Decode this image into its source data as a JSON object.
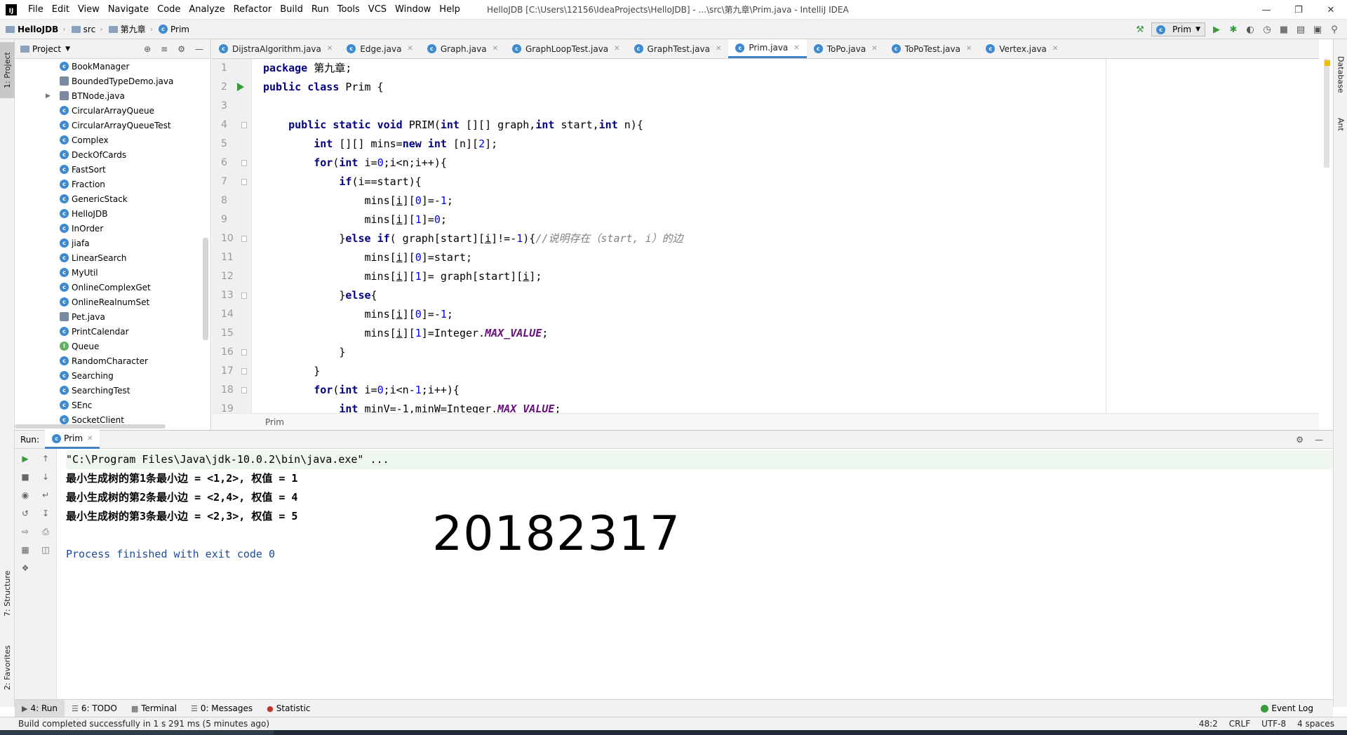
{
  "titlebar": {
    "menus": [
      "File",
      "Edit",
      "View",
      "Navigate",
      "Code",
      "Analyze",
      "Refactor",
      "Build",
      "Run",
      "Tools",
      "VCS",
      "Window",
      "Help"
    ],
    "title": "HelloJDB [C:\\Users\\12156\\IdeaProjects\\HelloJDB] - ...\\src\\第九章\\Prim.java - IntelliJ IDEA"
  },
  "navbar": {
    "crumbs": [
      "HelloJDB",
      "src",
      "第九章",
      "Prim"
    ],
    "run_config": "Prim"
  },
  "left_stripe": {
    "project_tab": "1: Project",
    "structure_tab": "7: Structure",
    "favorites_tab": "2: Favorites"
  },
  "right_stripe": {
    "database_tab": "Database",
    "ant_tab": "Ant"
  },
  "project": {
    "title": "Project",
    "items": [
      {
        "name": "BookManager",
        "kind": "class"
      },
      {
        "name": "BoundedTypeDemo.java",
        "kind": "file"
      },
      {
        "name": "BTNode.java",
        "kind": "file"
      },
      {
        "name": "CircularArrayQueue",
        "kind": "class"
      },
      {
        "name": "CircularArrayQueueTest",
        "kind": "class"
      },
      {
        "name": "Complex",
        "kind": "class"
      },
      {
        "name": "DeckOfCards",
        "kind": "class"
      },
      {
        "name": "FastSort",
        "kind": "class"
      },
      {
        "name": "Fraction",
        "kind": "class"
      },
      {
        "name": "GenericStack",
        "kind": "class"
      },
      {
        "name": "HelloJDB",
        "kind": "class"
      },
      {
        "name": "InOrder",
        "kind": "class"
      },
      {
        "name": "jiafa",
        "kind": "class"
      },
      {
        "name": "LinearSearch",
        "kind": "class"
      },
      {
        "name": "MyUtil",
        "kind": "class"
      },
      {
        "name": "OnlineComplexGet",
        "kind": "class"
      },
      {
        "name": "OnlineRealnumSet",
        "kind": "class"
      },
      {
        "name": "Pet.java",
        "kind": "file"
      },
      {
        "name": "PrintCalendar",
        "kind": "class"
      },
      {
        "name": "Queue",
        "kind": "interface"
      },
      {
        "name": "RandomCharacter",
        "kind": "class"
      },
      {
        "name": "Searching",
        "kind": "class"
      },
      {
        "name": "SearchingTest",
        "kind": "class"
      },
      {
        "name": "SEnc",
        "kind": "class"
      },
      {
        "name": "SocketClient",
        "kind": "class"
      }
    ]
  },
  "editor": {
    "tabs": [
      "DijstraAlgorithm.java",
      "Edge.java",
      "Graph.java",
      "GraphLoopTest.java",
      "GraphTest.java",
      "Prim.java",
      "ToPo.java",
      "ToPoTest.java",
      "Vertex.java"
    ],
    "active_tab": "Prim.java",
    "line_numbers": [
      "1",
      "2",
      "3",
      "4",
      "5",
      "6",
      "7",
      "8",
      "9",
      "10",
      "11",
      "12",
      "13",
      "14",
      "15",
      "16",
      "17",
      "18",
      "19"
    ],
    "code_lines": [
      "package 第九章;",
      "public class Prim {",
      "",
      "    public static void PRIM(int [][] graph,int start,int n){",
      "        int [][] mins=new int [n][2];",
      "        for(int i=0;i<n;i++){",
      "            if(i==start){",
      "                mins[i][0]=-1;",
      "                mins[i][1]=0;",
      "            }else if( graph[start][i]!=-1){//说明存在（start, i）的边",
      "                mins[i][0]=start;",
      "                mins[i][1]= graph[start][i];",
      "            }else{",
      "                mins[i][0]=-1;",
      "                mins[i][1]=Integer.MAX_VALUE;",
      "            }",
      "        }",
      "        for(int i=0;i<n-1;i++){",
      "            int minV=-1,minW=Integer.MAX_VALUE;"
    ],
    "breadcrumb": "Prim"
  },
  "run": {
    "label": "Run:",
    "tab": "Prim",
    "console": [
      "\"C:\\Program Files\\Java\\jdk-10.0.2\\bin\\java.exe\" ...",
      "最小生成树的第1条最小边 = <1,2>, 权值 = 1",
      "最小生成树的第2条最小边 = <2,4>, 权值 = 4",
      "最小生成树的第3条最小边 = <2,3>, 权值 = 5",
      "",
      "Process finished with exit code 0"
    ],
    "overlay_number": "20182317"
  },
  "bottom_tools": {
    "run": "4: Run",
    "todo": "6: TODO",
    "terminal": "Terminal",
    "messages": "0: Messages",
    "statistic": "Statistic",
    "event_log": "Event Log"
  },
  "status": {
    "message": "Build completed successfully in 1 s 291 ms (5 minutes ago)",
    "position": "48:2",
    "line_sep": "CRLF",
    "encoding": "UTF-8",
    "indent": "4 spaces"
  },
  "colors": {
    "accent": "#4083c9",
    "keyword": "#000080",
    "number": "#0000ff",
    "field": "#660e7a",
    "comment": "#808080"
  }
}
